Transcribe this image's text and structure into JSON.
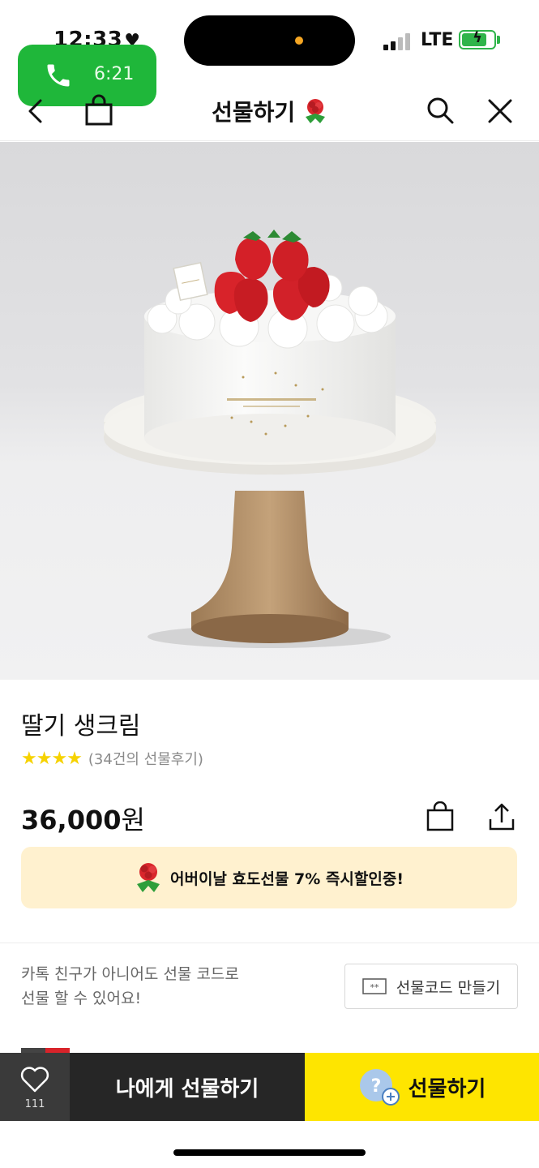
{
  "status_bar": {
    "time": "12:33",
    "time_suffix": "♥",
    "network": "LTE",
    "colors": {
      "battery": "#2fb44a",
      "island_dot": "#f5a623"
    }
  },
  "call_pill": {
    "duration": "6:21",
    "icon": "phone-icon",
    "color": "#1fb73a"
  },
  "nav": {
    "title": "선물하기",
    "icons": [
      "back-icon",
      "shopping-bag-icon",
      "rose-icon",
      "search-icon",
      "close-icon"
    ]
  },
  "product": {
    "image_icon": "product-image",
    "name": "딸기 생크림",
    "stars": "★★★★",
    "rating_value": 4,
    "review_count": "(34건의 선물후기)",
    "price": "36,000",
    "price_unit": "원",
    "actions": [
      "gift-bag-icon",
      "share-icon"
    ]
  },
  "promo": {
    "text": "어버이날 효도선물 7% 즉시할인중!",
    "icon": "carnation-icon",
    "background": "#fff1cf"
  },
  "gift_code": {
    "line1": "카톡 친구가 아니어도 선물 코드로",
    "line2": "선물 할 수 있어요!",
    "button_label": "선물코드 만들기",
    "button_icon": "code-icon"
  },
  "bottom_bar": {
    "wish_count": "111",
    "self_gift_label": "나에게 선물하기",
    "gift_label": "선물하기",
    "colors": {
      "wish_bg": "#3a3a3a",
      "self_gift_bg": "#262626",
      "gift_bg": "#fee500"
    }
  }
}
